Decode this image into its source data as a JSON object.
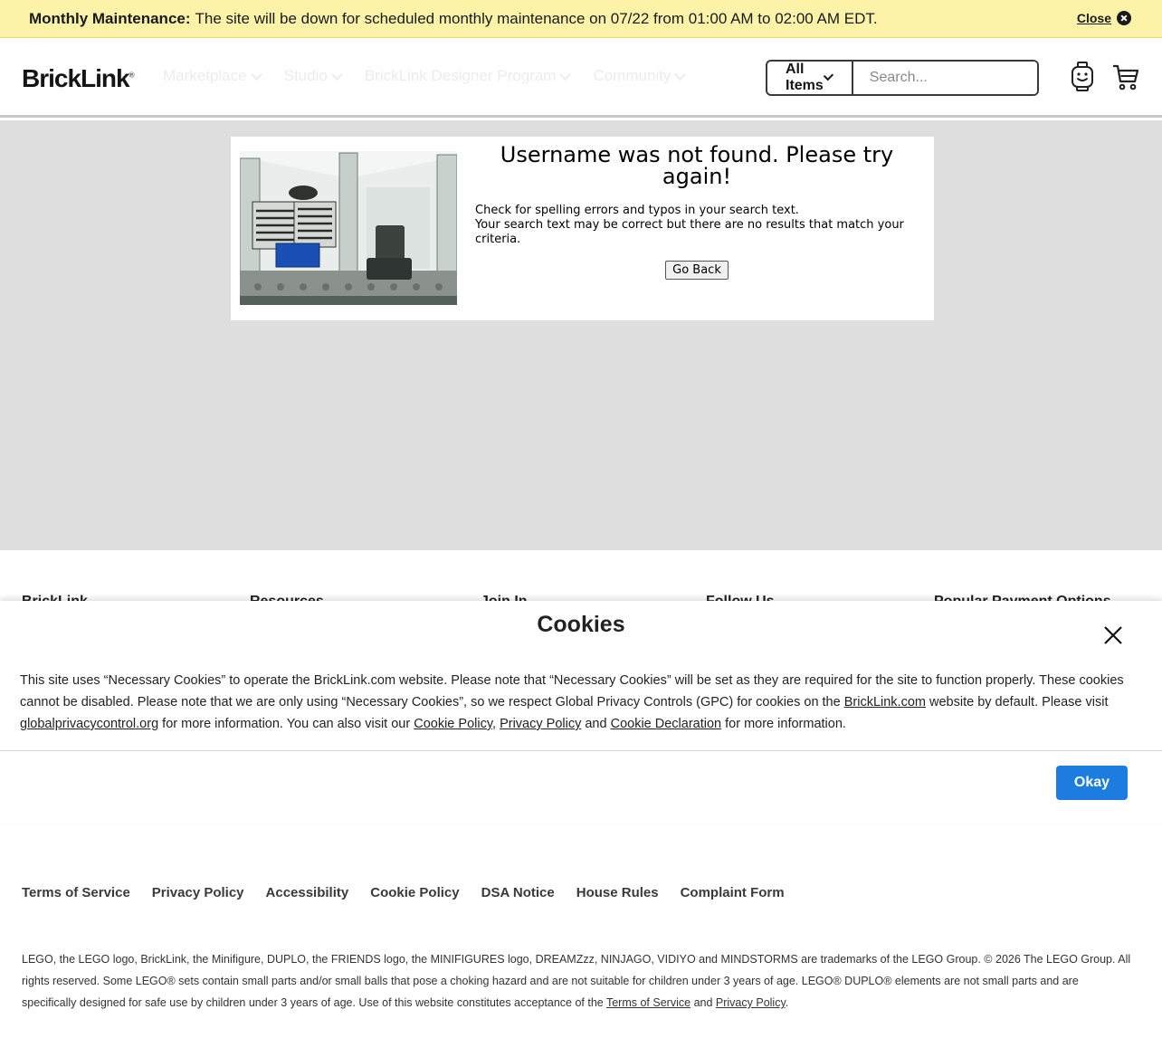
{
  "banner": {
    "label": "Monthly Maintenance:",
    "text": "The site will be down for scheduled monthly maintenance on 07/22 from 01:00 AM to 02:00 AM EDT.",
    "close_label": "Close"
  },
  "header": {
    "logo": "BrickLink",
    "nav": [
      "Marketplace",
      "Studio",
      "BrickLink Designer Program",
      "Community"
    ],
    "search": {
      "category": "All Items",
      "placeholder": "Search..."
    }
  },
  "error": {
    "title": "Username was not found. Please try again!",
    "line1": "Check for spelling errors and typos in your search text.",
    "line2": "Your search text may be correct but there are no results that match your criteria.",
    "button": "Go Back"
  },
  "footer": {
    "headings": [
      "BrickLink",
      "Resources",
      "Join In",
      "Follow Us",
      "Popular Payment Options"
    ],
    "links": [
      "Terms of Service",
      "Privacy Policy",
      "Accessibility",
      "Cookie Policy",
      "DSA Notice",
      "House Rules",
      "Complaint Form"
    ],
    "legal": {
      "text": "LEGO, the LEGO logo, BrickLink, the Minifigure, DUPLO, the FRIENDS logo, the MINIFIGURES logo, DREAMZzz, NINJAGO, VIDIYO and MINDSTORMS are trademarks of the LEGO Group. © 2026 The LEGO Group. All rights reserved. Some LEGO® sets contain small parts and/or small balls that pose a choking hazard and are not suitable for children under 3 years of age. LEGO® DUPLO® elements are not small parts and are specifically designed for safe use by children under 3 years of age. Use of this website constitutes acceptance of the",
      "tos": "Terms of Service",
      "and": "and",
      "privacy": "Privacy Policy",
      "end": "."
    }
  },
  "cookie": {
    "title": "Cookies",
    "text1": "This site uses “Necessary Cookies” to operate the BrickLink.com website. Please note that “Necessary Cookies” will be set as they are required for the site to function properly. These cookies cannot be disabled. Please note that we are only using “Necessary Cookies”, so we respect Global Privacy Controls (GPC) for cookies on the",
    "link_bricklink": "BrickLink.com",
    "text2": "website by default. Please visit",
    "link_gpc": "globalprivacycontrol.org",
    "text3": "for more information. You can also visit our",
    "link_cookie_policy": "Cookie Policy",
    "comma": ",",
    "link_privacy": "Privacy Policy",
    "and": "and",
    "link_declaration": "Cookie Declaration",
    "text4": "for more information.",
    "okay": "Okay"
  },
  "colors": {
    "accent": "#1d7ce0",
    "banner_bg": "#fcf3a8",
    "main_bg": "#dedede"
  },
  "icons": [
    "close-circle-icon",
    "chevron-down-icon",
    "search-icon",
    "minifigure-icon",
    "cart-icon",
    "close-icon"
  ]
}
